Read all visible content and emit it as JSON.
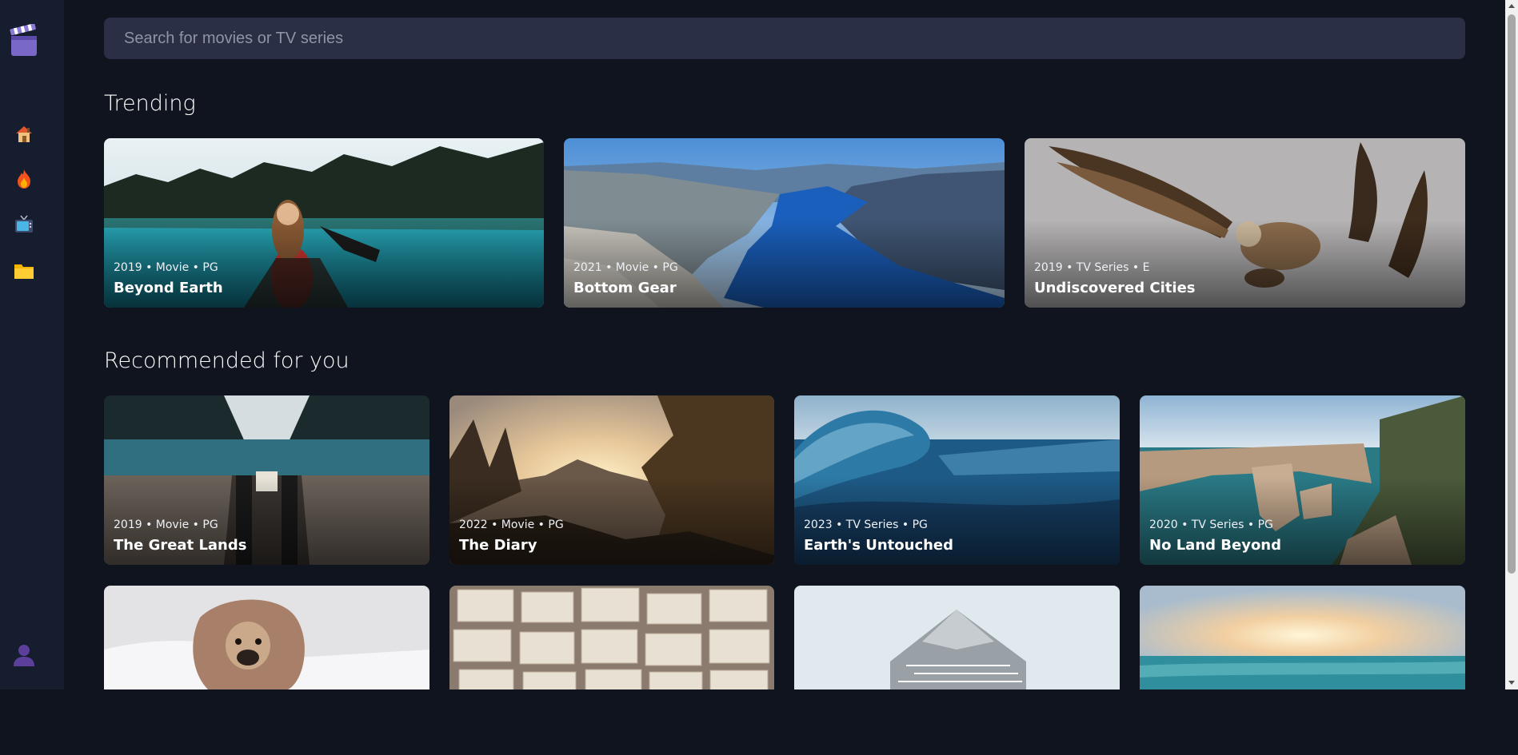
{
  "search": {
    "placeholder": "Search for movies or TV series"
  },
  "sections": {
    "trending": "Trending",
    "recommended": "Recommended for you"
  },
  "trending": [
    {
      "meta": "2019 • Movie • PG",
      "title": "Beyond Earth"
    },
    {
      "meta": "2021 • Movie • PG",
      "title": "Bottom Gear"
    },
    {
      "meta": "2019 • TV Series • E",
      "title": "Undiscovered Cities"
    }
  ],
  "recommended": [
    {
      "meta": "2019 • Movie • PG",
      "title": "The Great Lands"
    },
    {
      "meta": "2022 • Movie • PG",
      "title": "The Diary"
    },
    {
      "meta": "2023 • TV Series • PG",
      "title": "Earth's Untouched"
    },
    {
      "meta": "2020 • TV Series • PG",
      "title": "No Land Beyond"
    }
  ],
  "icons": {
    "logo": "clapperboard-icon",
    "home": "house-icon",
    "trending": "fire-icon",
    "tv": "television-icon",
    "bookmarks": "folder-icon",
    "profile": "user-avatar-icon"
  },
  "colors": {
    "background": "#10141e",
    "sidebar": "#161d2f",
    "search": "#2a2f45"
  }
}
